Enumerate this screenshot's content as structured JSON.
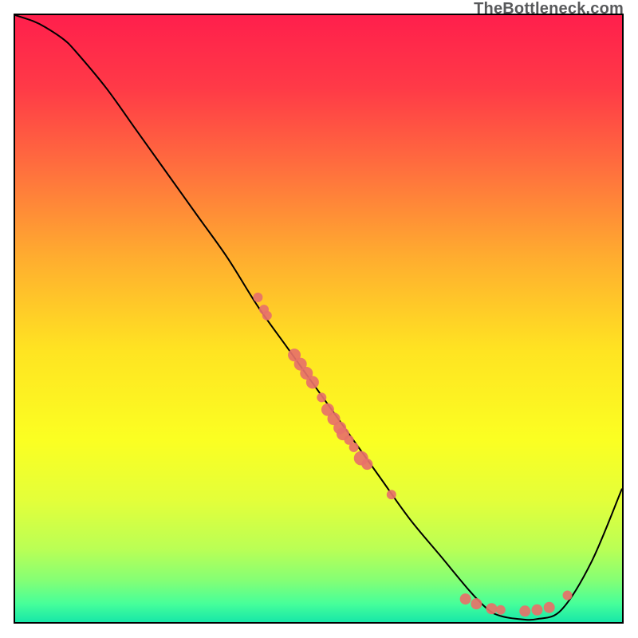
{
  "attribution": "TheBottleneck.com",
  "chart_data": {
    "type": "line",
    "title": "",
    "xlabel": "",
    "ylabel": "",
    "xlim": [
      0,
      100
    ],
    "ylim": [
      0,
      100
    ],
    "series": [
      {
        "name": "bottleneck-curve",
        "x": [
          0,
          3,
          5,
          8,
          10,
          15,
          20,
          25,
          30,
          35,
          40,
          45,
          50,
          55,
          60,
          65,
          70,
          75,
          78,
          80,
          83,
          86,
          90,
          95,
          100
        ],
        "y": [
          100,
          99,
          98,
          96,
          94,
          88,
          81,
          74,
          67,
          60,
          52,
          45,
          38,
          31,
          24,
          17,
          11,
          5,
          2,
          1,
          0.5,
          0.5,
          2,
          10,
          22
        ]
      }
    ],
    "markers": {
      "name": "highlighted-points",
      "color": "#e77169",
      "points": [
        {
          "x": 40.0,
          "y": 53.5,
          "r": 6
        },
        {
          "x": 41.0,
          "y": 51.5,
          "r": 6
        },
        {
          "x": 41.5,
          "y": 50.5,
          "r": 6
        },
        {
          "x": 46.0,
          "y": 44.0,
          "r": 8
        },
        {
          "x": 47.0,
          "y": 42.5,
          "r": 8
        },
        {
          "x": 48.0,
          "y": 41.0,
          "r": 8
        },
        {
          "x": 49.0,
          "y": 39.5,
          "r": 8
        },
        {
          "x": 50.5,
          "y": 37.0,
          "r": 6
        },
        {
          "x": 51.5,
          "y": 35.0,
          "r": 8
        },
        {
          "x": 52.5,
          "y": 33.5,
          "r": 8
        },
        {
          "x": 53.5,
          "y": 32.0,
          "r": 8
        },
        {
          "x": 54.0,
          "y": 31.0,
          "r": 8
        },
        {
          "x": 55.0,
          "y": 30.0,
          "r": 6
        },
        {
          "x": 55.8,
          "y": 28.8,
          "r": 6
        },
        {
          "x": 57.0,
          "y": 27.0,
          "r": 9
        },
        {
          "x": 58.0,
          "y": 26.0,
          "r": 7
        },
        {
          "x": 62.0,
          "y": 21.0,
          "r": 6
        },
        {
          "x": 74.2,
          "y": 3.8,
          "r": 7
        },
        {
          "x": 76.0,
          "y": 3.0,
          "r": 7
        },
        {
          "x": 78.5,
          "y": 2.2,
          "r": 7
        },
        {
          "x": 80.0,
          "y": 2.0,
          "r": 6
        },
        {
          "x": 84.0,
          "y": 1.8,
          "r": 7
        },
        {
          "x": 86.0,
          "y": 2.0,
          "r": 7
        },
        {
          "x": 88.0,
          "y": 2.4,
          "r": 7
        },
        {
          "x": 91.0,
          "y": 4.4,
          "r": 6
        }
      ]
    },
    "background_gradient": {
      "type": "vertical",
      "stops": [
        {
          "offset": 0.0,
          "color": "#ff1f4c"
        },
        {
          "offset": 0.12,
          "color": "#ff3a47"
        },
        {
          "offset": 0.25,
          "color": "#ff6e3e"
        },
        {
          "offset": 0.4,
          "color": "#ffad2f"
        },
        {
          "offset": 0.55,
          "color": "#ffe322"
        },
        {
          "offset": 0.7,
          "color": "#fbff22"
        },
        {
          "offset": 0.8,
          "color": "#e3ff3a"
        },
        {
          "offset": 0.88,
          "color": "#baff55"
        },
        {
          "offset": 0.93,
          "color": "#86ff74"
        },
        {
          "offset": 0.97,
          "color": "#46ff9a"
        },
        {
          "offset": 1.0,
          "color": "#18e7a8"
        }
      ]
    }
  }
}
